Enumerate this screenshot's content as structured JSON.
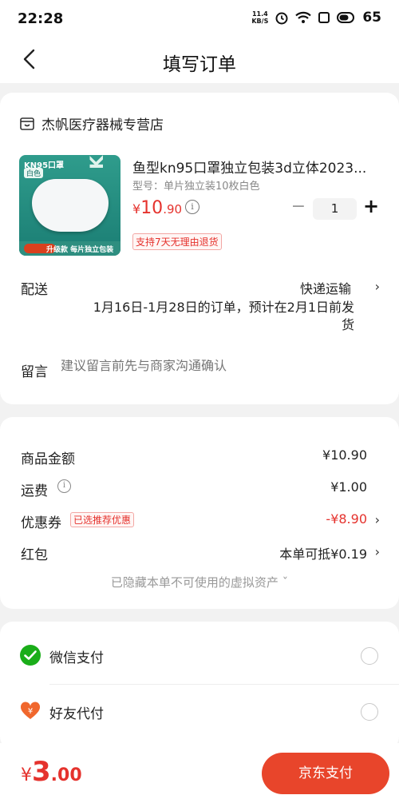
{
  "status_bar": {
    "time": "22:28",
    "net_speed_value": "11.4",
    "net_speed_unit": "KB/S",
    "battery": "65",
    "icons": [
      "alarm-icon",
      "wifi-icon",
      "screen-icon",
      "battery-icon"
    ]
  },
  "header": {
    "title": "填写订单",
    "back_icon": "back-arrow-icon"
  },
  "order": {
    "shop_name": "杰帆医疗器械专营店",
    "product": {
      "title": "鱼型kn95口罩独立包装3d立体2023...",
      "spec": "型号：单片独立装10枚白色",
      "price_currency": "¥",
      "price_int": "10",
      "price_dec": ".90",
      "quantity": "1",
      "return_badge": "支持7天无理由退货",
      "thumb_tag": "KN95口罩",
      "thumb_color_tag": "白色",
      "thumb_kn": "KN95",
      "thumb_footer": "升级款 每片独立包装"
    },
    "shipping_label": "配送",
    "shipping_method": "快递运输",
    "shipping_note": "1月16日-1月28日的订单，预计在2月1日前发货",
    "message_label": "留言",
    "message_placeholder": "建议留言前先与商家沟通确认"
  },
  "summary": {
    "goods_amount_label": "商品金额",
    "goods_amount": "¥10.90",
    "freight_label": "运费",
    "freight": "¥1.00",
    "coupon_label": "优惠券",
    "coupon_tag": "已选推荐优惠",
    "coupon_value": "-¥8.90",
    "redpacket_label": "红包",
    "redpacket_value": "本单可抵¥0.19",
    "hidden_assets": "已隐藏本单不可使用的虚拟资产 ˇ"
  },
  "payment": {
    "options": [
      {
        "label": "微信支付",
        "icon": "wechat-pay-icon"
      },
      {
        "label": "好友代付",
        "icon": "friend-pay-icon"
      }
    ]
  },
  "bottom_bar": {
    "total_currency": "¥",
    "total_int": "3",
    "total_dec": ".00",
    "submit_label": "京东支付"
  },
  "colors": {
    "accent": "#e5322d",
    "button": "#e8452b",
    "wechat": "#1aad19"
  }
}
